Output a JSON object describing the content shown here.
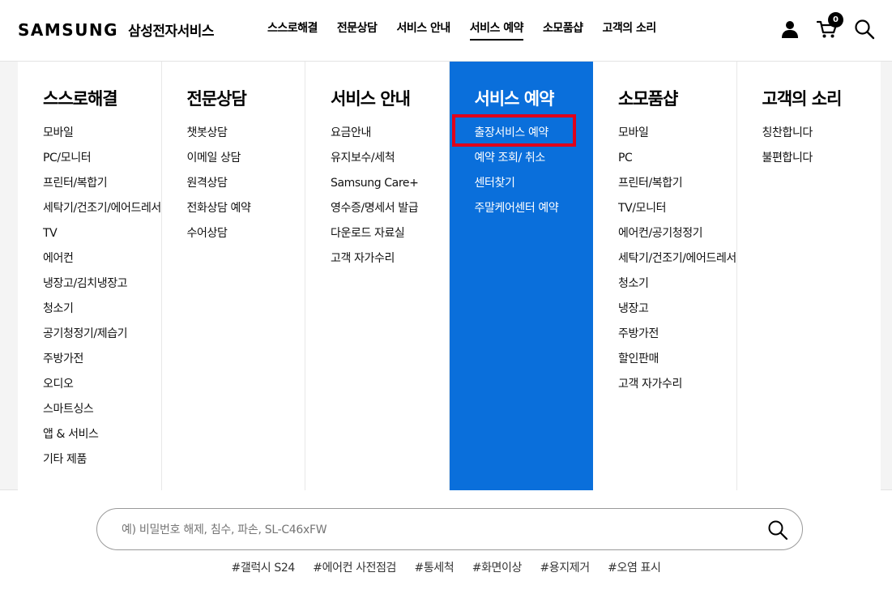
{
  "header": {
    "logo_word": "SAMSUNG",
    "logo_sub": "삼성전자서비스",
    "nav": [
      {
        "label": "스스로해결",
        "active": false
      },
      {
        "label": "전문상담",
        "active": false
      },
      {
        "label": "서비스 안내",
        "active": false
      },
      {
        "label": "서비스 예약",
        "active": true
      },
      {
        "label": "소모품샵",
        "active": false
      },
      {
        "label": "고객의 소리",
        "active": false
      }
    ],
    "icons": {
      "account": "person-icon",
      "cart": "cart-icon",
      "search": "search-icon"
    },
    "cart_count": "0"
  },
  "mega_menu": {
    "accent_color": "#0a6fdb",
    "highlight_color": "#e0001a",
    "columns": [
      {
        "title": "스스로해결",
        "items": [
          "모바일",
          "PC/모니터",
          "프린터/복합기",
          "세탁기/건조기/에어드레서",
          "TV",
          "에어컨",
          "냉장고/김치냉장고",
          "청소기",
          "공기청정기/제습기",
          "주방가전",
          "오디오",
          "스마트싱스",
          "앱 & 서비스",
          "기타 제품"
        ]
      },
      {
        "title": "전문상담",
        "items": [
          "챗봇상담",
          "이메일 상담",
          "원격상담",
          "전화상담 예약",
          "수어상담"
        ]
      },
      {
        "title": "서비스 안내",
        "items": [
          "요금안내",
          "유지보수/세척",
          "Samsung Care+",
          "영수증/명세서 발급",
          "다운로드 자료실",
          "고객 자가수리"
        ]
      },
      {
        "title": "서비스 예약",
        "items": [
          "출장서비스 예약",
          "예약 조회/ 취소",
          "센터찾기",
          "주말케어센터 예약"
        ]
      },
      {
        "title": "소모품샵",
        "items": [
          "모바일",
          "PC",
          "프린터/복합기",
          "TV/모니터",
          "에어컨/공기청정기",
          "세탁기/건조기/에어드레서",
          "청소기",
          "냉장고",
          "주방가전",
          "할인판매",
          "고객 자가수리"
        ]
      },
      {
        "title": "고객의 소리",
        "items": [
          "칭찬합니다",
          "불편합니다"
        ]
      }
    ]
  },
  "search": {
    "placeholder": "예) 비밀번호 해제, 침수, 파손, SL-C46xFW",
    "value": "",
    "tags": [
      "#갤럭시 S24",
      "#에어컨 사전점검",
      "#통세척",
      "#화면이상",
      "#용지제거",
      "#오염 표시"
    ]
  }
}
